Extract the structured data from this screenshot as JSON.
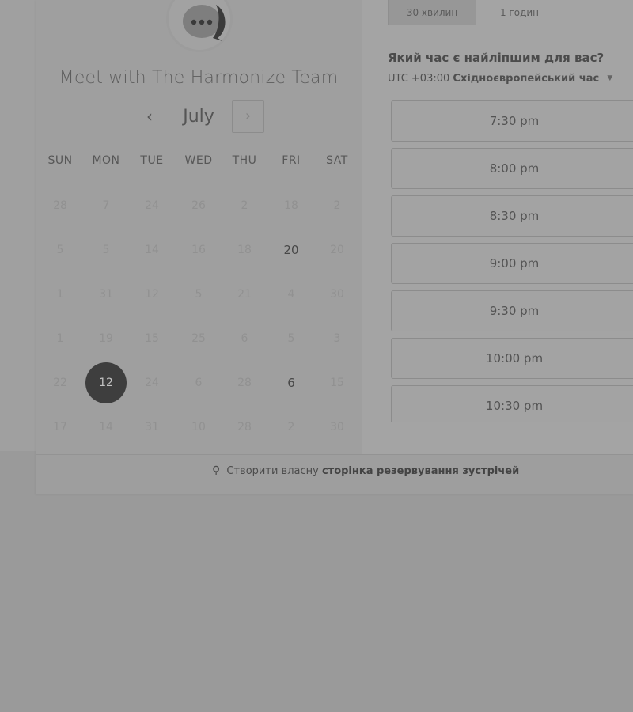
{
  "event": {
    "title": "Meet with The Harmonize Team",
    "logo_icon": "chat-bubble-icon"
  },
  "calendar": {
    "month": "July",
    "prev_icon": "‹",
    "next_icon": "›",
    "weekdays": [
      "SUN",
      "MON",
      "TUE",
      "WED",
      "THU",
      "FRI",
      "SAT"
    ],
    "weeks": [
      [
        {
          "d": "28",
          "s": "u"
        },
        {
          "d": "7",
          "s": "u"
        },
        {
          "d": "24",
          "s": "u"
        },
        {
          "d": "26",
          "s": "u"
        },
        {
          "d": "2",
          "s": "u"
        },
        {
          "d": "18",
          "s": "u"
        },
        {
          "d": "2",
          "s": "u"
        }
      ],
      [
        {
          "d": "5",
          "s": "u"
        },
        {
          "d": "5",
          "s": "u"
        },
        {
          "d": "14",
          "s": "u"
        },
        {
          "d": "16",
          "s": "u"
        },
        {
          "d": "18",
          "s": "u"
        },
        {
          "d": "20",
          "s": "a"
        },
        {
          "d": "20",
          "s": "u"
        }
      ],
      [
        {
          "d": "1",
          "s": "u"
        },
        {
          "d": "31",
          "s": "u"
        },
        {
          "d": "12",
          "s": "u"
        },
        {
          "d": "5",
          "s": "u"
        },
        {
          "d": "21",
          "s": "u"
        },
        {
          "d": "4",
          "s": "u"
        },
        {
          "d": "30",
          "s": "u"
        }
      ],
      [
        {
          "d": "1",
          "s": "u"
        },
        {
          "d": "19",
          "s": "u"
        },
        {
          "d": "15",
          "s": "u"
        },
        {
          "d": "25",
          "s": "u"
        },
        {
          "d": "6",
          "s": "u"
        },
        {
          "d": "5",
          "s": "u"
        },
        {
          "d": "3",
          "s": "u"
        }
      ],
      [
        {
          "d": "22",
          "s": "u"
        },
        {
          "d": "12",
          "s": "sel"
        },
        {
          "d": "24",
          "s": "u"
        },
        {
          "d": "6",
          "s": "u"
        },
        {
          "d": "28",
          "s": "u"
        },
        {
          "d": "6",
          "s": "a"
        },
        {
          "d": "15",
          "s": "u"
        }
      ],
      [
        {
          "d": "17",
          "s": "u"
        },
        {
          "d": "14",
          "s": "u"
        },
        {
          "d": "31",
          "s": "u"
        },
        {
          "d": "10",
          "s": "u"
        },
        {
          "d": "28",
          "s": "u"
        },
        {
          "d": "2",
          "s": "u"
        },
        {
          "d": "30",
          "s": "u"
        }
      ]
    ]
  },
  "duration": {
    "tabs": [
      {
        "label": "30 хвилин",
        "active": true
      },
      {
        "label": "1 годин",
        "active": false
      }
    ]
  },
  "times": {
    "question": "Який час є найліпшим для вас?",
    "tz_offset": "UTC +03:00",
    "tz_name": "Східноєвропейський час",
    "slots": [
      "7:30 pm",
      "8:00 pm",
      "8:30 pm",
      "9:00 pm",
      "9:30 pm",
      "10:00 pm",
      "10:30 pm"
    ]
  },
  "footer": {
    "prefix": "Створити власну",
    "strong": "сторінка резервування зустрічей",
    "icon": "hubspot-sprocket-icon"
  }
}
